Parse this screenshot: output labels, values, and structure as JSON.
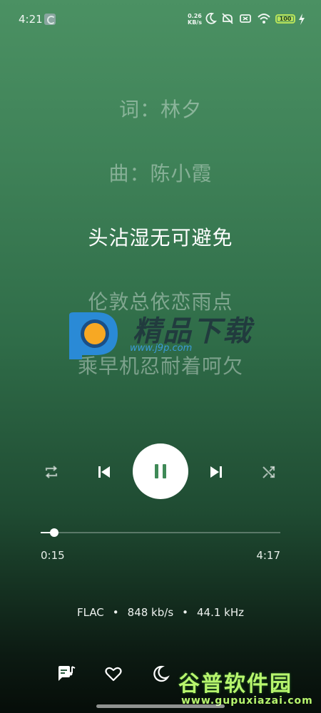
{
  "status_bar": {
    "time": "4:21",
    "net_speed_value": "0.26",
    "net_speed_unit": "KB/s",
    "battery_level": "100"
  },
  "lyrics": [
    {
      "text": "词：林夕",
      "state": "dim"
    },
    {
      "text": "曲：陈小霞",
      "state": "dim"
    },
    {
      "text": "头沾湿无可避免",
      "state": "active"
    },
    {
      "text": "伦敦总依恋雨点",
      "state": "dim"
    },
    {
      "text": "乘早机忍耐着呵欠",
      "state": "dim"
    }
  ],
  "watermark": {
    "title": "精品下载",
    "url": "www.j9p.com",
    "bottom_title": "谷普软件园",
    "bottom_url": "www.gupuxiazai.com"
  },
  "player": {
    "state": "playing",
    "elapsed": "0:15",
    "duration": "4:17",
    "progress": 0.058
  },
  "audio_info": {
    "format": "FLAC",
    "separator": "•",
    "bitrate": "848 kb/s",
    "sample_rate": "44.1 kHz"
  },
  "icons": {
    "repeat": "repeat-icon",
    "previous": "skip-previous-icon",
    "play_pause": "pause-icon",
    "next": "skip-next-icon",
    "shuffle": "shuffle-icon",
    "lyrics": "lyrics-icon",
    "favorite": "heart-icon",
    "sleep": "moon-icon"
  },
  "colors": {
    "accent": "#3f8a57",
    "background_top": "#4b9163",
    "background_bottom": "#060d09"
  }
}
